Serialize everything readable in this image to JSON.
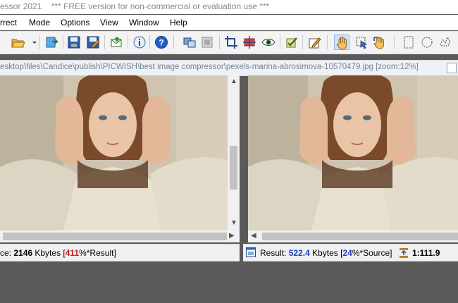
{
  "window": {
    "title_fragment": "essor 2021",
    "notice": "*** FREE version for non-commercial or evaluation use ***"
  },
  "menu": {
    "correct": "rrect",
    "mode": "Mode",
    "options": "Options",
    "view": "View",
    "window": "Window",
    "help": "Help"
  },
  "toolbar": {
    "icons": [
      "open-icon",
      "export-icon",
      "save-icon",
      "save-as-icon",
      "send-icon",
      "info-icon",
      "help-icon",
      "compare-view-icon",
      "single-view-icon",
      "crop-icon",
      "resize-icon",
      "preview-eye-icon",
      "optimize-icon",
      "edit-icon",
      "hand-tool-icon",
      "zoom-tool-icon",
      "grab-tool-icon",
      "rect-select-icon",
      "ellipse-select-icon",
      "freeform-select-icon"
    ]
  },
  "path": {
    "text": "esktop\\files\\Candice\\publish\\PICWISH\\best image compressor\\pexels-marina-abrosimova-10570479.jpg  [zoom:12%]"
  },
  "source_status": {
    "prefix": "ce: ",
    "size": "2146",
    "unit": " Kbytes  [",
    "percent": "411",
    "suffix": "%*Result]"
  },
  "result_status": {
    "label": "Result: ",
    "size": "522.4",
    "unit": " Kbytes  [",
    "percent": "24",
    "suffix": "%*Source]",
    "ratio": "1:111.9"
  },
  "colors": {
    "accent_blue": "#1c3fc8",
    "accent_red": "#d01010",
    "toolbar_bg": "#f3f3f3",
    "workspace_bg": "#5a5a5a"
  }
}
